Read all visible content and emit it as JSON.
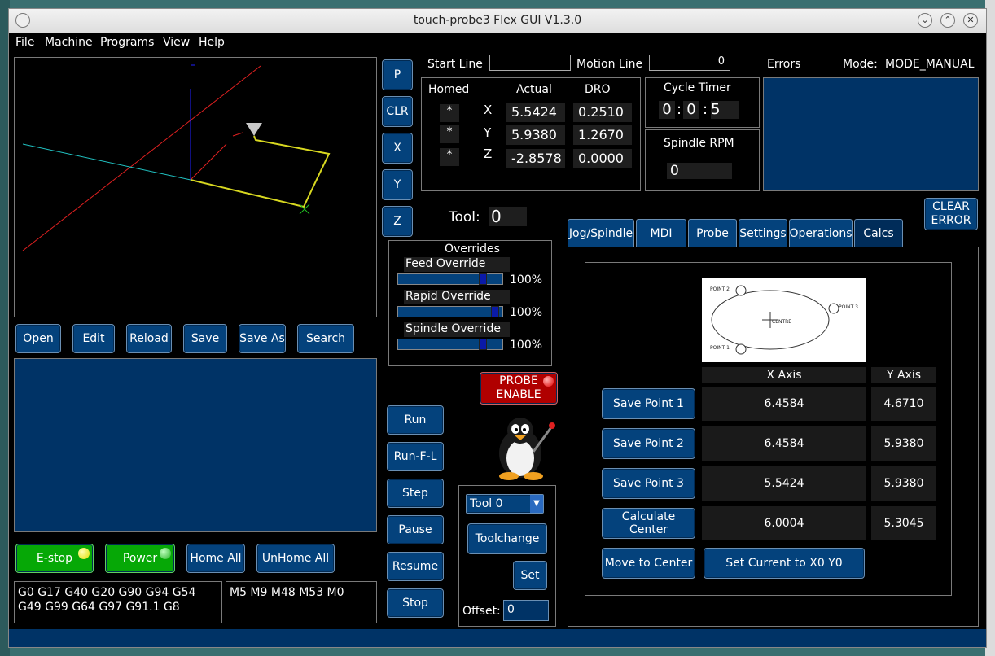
{
  "window": {
    "title": "touch-probe3 Flex GUI V1.3.0"
  },
  "menu": [
    "File",
    "Machine",
    "Programs",
    "View",
    "Help"
  ],
  "sidebar_buttons": [
    "P",
    "CLR",
    "X",
    "Y",
    "Z"
  ],
  "file_buttons": [
    "Open",
    "Edit",
    "Reload",
    "Save",
    "Save As",
    "Search"
  ],
  "start_line": {
    "label": "Start Line",
    "value": ""
  },
  "motion_line": {
    "label": "Motion Line",
    "value": "0"
  },
  "errors": {
    "label": "Errors"
  },
  "mode": {
    "label": "Mode:",
    "value": "MODE_MANUAL"
  },
  "dro": {
    "headers": {
      "homed": "Homed",
      "actual": "Actual",
      "dro": "DRO"
    },
    "rows": [
      {
        "homed": "*",
        "axis": "X",
        "actual": "5.5424",
        "dro": "0.2510"
      },
      {
        "homed": "*",
        "axis": "Y",
        "actual": "5.9380",
        "dro": "1.2670"
      },
      {
        "homed": "*",
        "axis": "Z",
        "actual": "-2.8578",
        "dro": "0.0000"
      }
    ]
  },
  "cycle_timer": {
    "label": "Cycle Timer",
    "h": "0",
    "m": "0",
    "s": "5"
  },
  "spindle": {
    "label": "Spindle RPM",
    "value": "0"
  },
  "tool": {
    "label": "Tool:",
    "value": "0"
  },
  "overrides": {
    "title": "Overrides",
    "items": [
      {
        "label": "Feed Override",
        "value": "100%",
        "level": 0.84
      },
      {
        "label": "Rapid Override",
        "value": "100%",
        "level": 0.97
      },
      {
        "label": "Spindle Override",
        "value": "100%",
        "level": 0.84
      }
    ]
  },
  "clear_error": {
    "line1": "CLEAR",
    "line2": "ERROR"
  },
  "tabs": [
    "Jog/Spindle",
    "MDI",
    "Probe",
    "Settings",
    "Operations",
    "Calcs"
  ],
  "probe_enable": {
    "line1": "PROBE",
    "line2": "ENABLE"
  },
  "run_buttons": [
    "Run",
    "Run-F-L",
    "Step",
    "Pause",
    "Resume",
    "Stop"
  ],
  "toolchange": {
    "select": "Tool 0",
    "button": "Toolchange",
    "set": "Set",
    "offset_label": "Offset:",
    "offset_value": "0"
  },
  "bottom_buttons": {
    "estop": "E-stop",
    "power": "Power",
    "home_all": "Home All",
    "unhome_all": "UnHome All"
  },
  "gcodes": {
    "g": "G0 G17 G40 G20 G90 G94 G54 G49 G99 G64 G97 G91.1 G8",
    "m": "M5 M9 M48 M53 M0"
  },
  "calcs": {
    "diagram": {
      "point1": "POINT 1",
      "point2": "POINT 2",
      "point3": "POINT 3",
      "centre": "CENTRE"
    },
    "headers": {
      "x": "X Axis",
      "y": "Y Axis"
    },
    "rows": [
      {
        "button": "Save Point 1",
        "x": "6.4584",
        "y": "4.6710"
      },
      {
        "button": "Save Point 2",
        "x": "6.4584",
        "y": "5.9380"
      },
      {
        "button": "Save Point 3",
        "x": "5.5424",
        "y": "5.9380"
      },
      {
        "button": "Calculate Center",
        "x": "6.0004",
        "y": "5.3045"
      }
    ],
    "move_to_center": "Move to Center",
    "set_current": "Set Current to X0 Y0"
  },
  "colors": {
    "button_blue": "#04427c",
    "panel_blue": "#003366",
    "estop_green": "#06a806",
    "probe_red": "#b00000"
  }
}
